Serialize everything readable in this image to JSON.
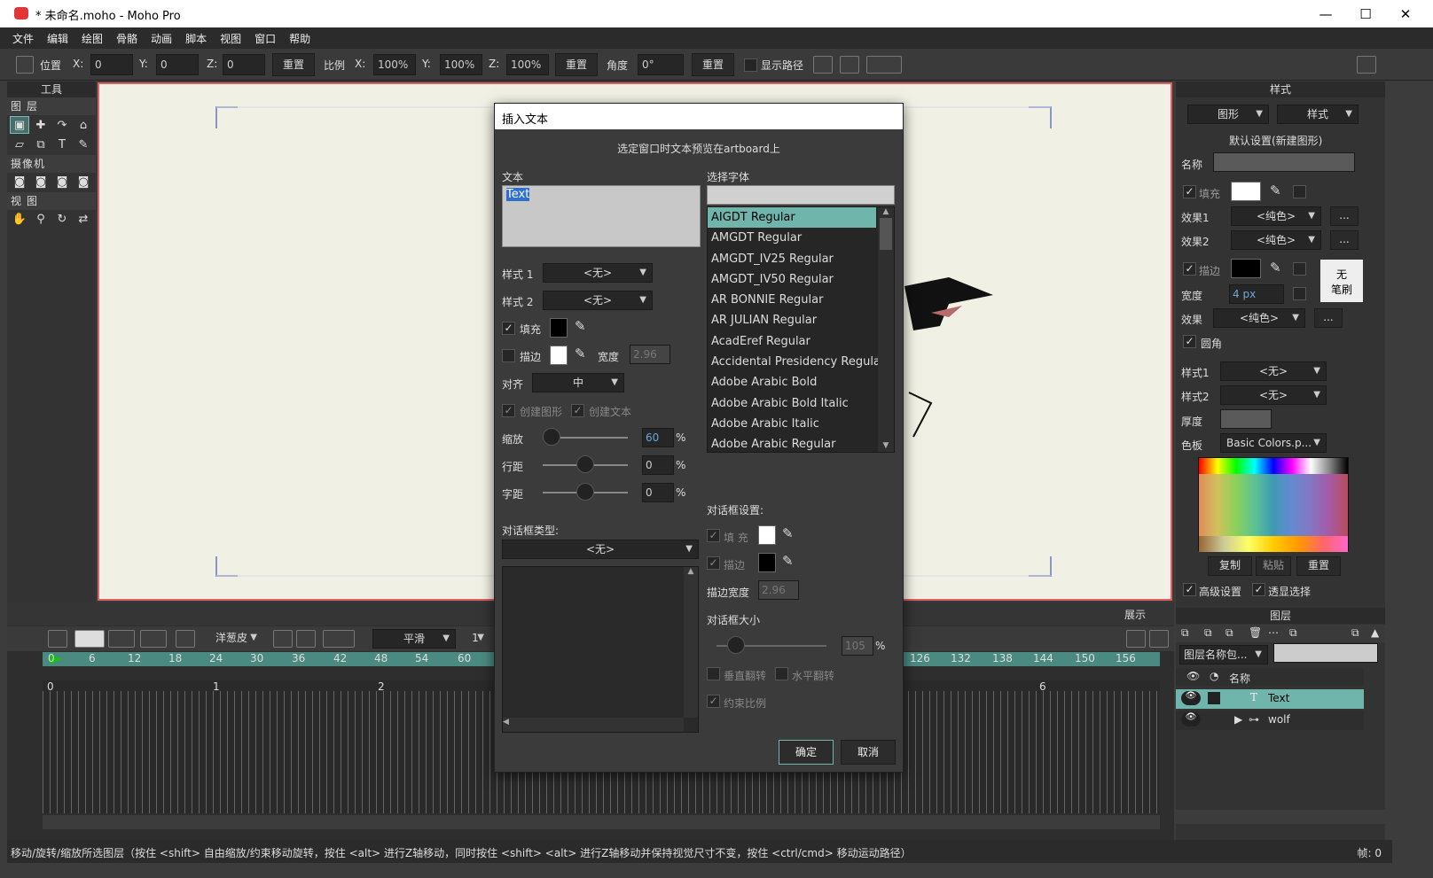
{
  "window": {
    "title": "* 未命名.moho - Moho Pro",
    "min": "—",
    "max": "☐",
    "close": "✕"
  },
  "menu": [
    "文件",
    "编辑",
    "绘图",
    "骨骼",
    "动画",
    "脚本",
    "视图",
    "窗口",
    "帮助"
  ],
  "toolbar": {
    "position_label": "位置",
    "x_label": "X:",
    "x": "0",
    "y_label": "Y:",
    "y": "0",
    "z_label": "Z:",
    "z": "0",
    "reset1": "重置",
    "scale_label": "比例",
    "sx_label": "X:",
    "sx": "100%",
    "sy_label": "Y:",
    "sy": "100%",
    "sz_label": "Z:",
    "sz": "100%",
    "reset2": "重置",
    "angle_label": "角度",
    "angle": "0°",
    "reset3": "重置",
    "show_path": "显示路径"
  },
  "tools": {
    "header": "工具",
    "layer_section": "图层",
    "camera_section": "摄像机",
    "view_section": "视图"
  },
  "dialog": {
    "title": "插入文本",
    "hint": "选定窗口时文本预览在artboard上",
    "text_label": "文本",
    "text_value": "Text",
    "font_label": "选择字体",
    "font_search": "",
    "fonts": [
      "AIGDT Regular",
      "AMGDT Regular",
      "AMGDT_IV25 Regular",
      "AMGDT_IV50 Regular",
      "AR BONNIE Regular",
      "AR JULIAN Regular",
      "AcadEref Regular",
      "Accidental Presidency Regular",
      "Adobe Arabic Bold",
      "Adobe Arabic Bold Italic",
      "Adobe Arabic Italic",
      "Adobe Arabic Regular"
    ],
    "style1_label": "样式 1",
    "style1": "<无>",
    "style2_label": "样式 2",
    "style2": "<无>",
    "fill_label": "填充",
    "stroke_label": "描边",
    "width_label": "宽度",
    "width_value": "2.96",
    "align_label": "对齐",
    "align": "中",
    "create_shape": "创建图形",
    "create_text": "创建文本",
    "scale_label": "缩放",
    "scale_value": "60",
    "scale_unit": "%",
    "line_label": "行距",
    "line_value": "0",
    "line_unit": "%",
    "char_label": "字距",
    "char_value": "0",
    "char_unit": "%",
    "bubble_type_label": "对话框类型:",
    "bubble_type": "<无>",
    "bubble_settings": "对话框设置:",
    "bubble_fill": "填 充",
    "bubble_stroke": "描边",
    "bubble_stroke_width_label": "描边宽度",
    "bubble_stroke_width": "2.96",
    "bubble_size_label": "对话框大小",
    "bubble_size": "105",
    "bubble_size_unit": "%",
    "flip_v": "垂直翻转",
    "flip_h": "水平翻转",
    "constrain": "约束比例",
    "ok": "确定",
    "cancel": "取消"
  },
  "timeline": {
    "onion": "洋葱皮",
    "interp": "平滑",
    "step": "1",
    "display": "展示",
    "frames_top": [
      "0",
      "6",
      "12",
      "18",
      "24",
      "30",
      "36",
      "42",
      "48",
      "54",
      "60",
      "126",
      "132",
      "138",
      "144",
      "150",
      "156"
    ],
    "seconds": [
      "0",
      "1",
      "2",
      "6"
    ]
  },
  "style_panel": {
    "header": "样式",
    "tab1": "图形",
    "tab2": "样式",
    "defaults": "默认设置(新建图形)",
    "name_label": "名称",
    "fill_label": "填充",
    "effect1_label": "效果1",
    "effect1": "<纯色>",
    "effect2_label": "效果2",
    "effect2": "<纯色>",
    "stroke_label": "描边",
    "no_brush": "无\n笔刷",
    "width_label": "宽度",
    "width": "4 px",
    "effect_label": "效果",
    "effect": "<纯色>",
    "round_cap": "圆角",
    "style1_label": "样式1",
    "style1": "<无>",
    "style2_label": "样式2",
    "style2": "<无>",
    "thickness_label": "厚度",
    "palette_label": "色板",
    "palette": "Basic Colors.p...",
    "copy": "复制",
    "paste": "粘贴",
    "reset": "重置",
    "advanced": "高级设置",
    "select_visible": "透显选择",
    "ellipsis": "..."
  },
  "layers_panel": {
    "header": "图层",
    "filter": "图层名称包...",
    "name_col": "名称",
    "layers": [
      {
        "name": "Text",
        "type": "T"
      },
      {
        "name": "wolf",
        "type": "bone"
      }
    ]
  },
  "status": {
    "text": "移动/旋转/缩放所选图层（按住 <shift> 自由缩放/约束移动旋转，按住 <alt> 进行Z轴移动，同时按住 <shift> <alt> 进行Z轴移动并保持视觉尺寸不变，按住 <ctrl/cmd> 移动运动路径）",
    "frame": "帧: 0"
  },
  "colors": {
    "accent": "#70b5ab",
    "artboard": "#f1f0e4",
    "border_red": "#e06060"
  }
}
